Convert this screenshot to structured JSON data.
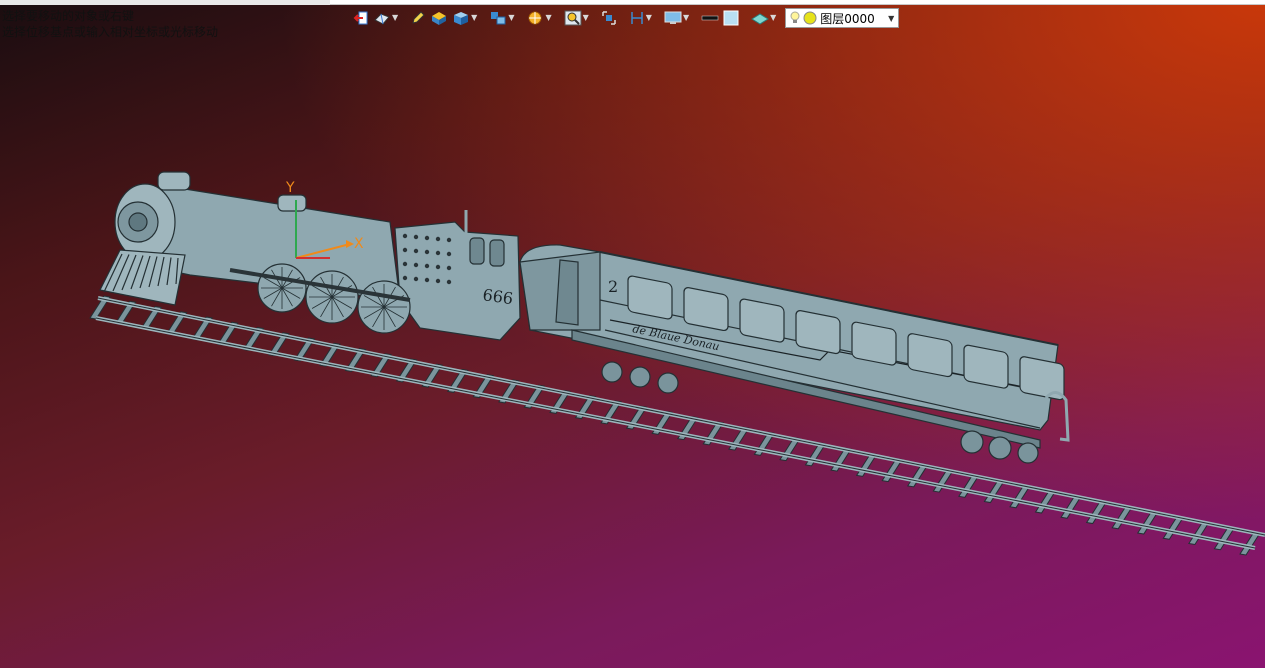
{
  "prompt": {
    "line1": "选择要移动的对象或右键",
    "line2": "选择位移基点或输入相对坐标或光标移动"
  },
  "toolbar": {
    "items": [
      {
        "name": "exit-icon",
        "dropdown": false
      },
      {
        "name": "view-icon",
        "dropdown": true
      },
      {
        "name": "pencil-icon",
        "dropdown": false
      },
      {
        "name": "shade-icon",
        "dropdown": false
      },
      {
        "name": "cube-icon",
        "dropdown": true
      },
      {
        "name": "cubes-icon",
        "dropdown": true
      },
      {
        "name": "section-icon",
        "dropdown": true
      },
      {
        "name": "zoom-icon",
        "dropdown": true
      },
      {
        "name": "fit-icon",
        "dropdown": false
      },
      {
        "name": "measure-icon",
        "dropdown": true
      },
      {
        "name": "display-icon",
        "dropdown": true
      },
      {
        "name": "line-color-icon",
        "dropdown": false
      },
      {
        "name": "fill-color-icon",
        "dropdown": false
      },
      {
        "name": "material-icon",
        "dropdown": true
      }
    ],
    "layer_select": {
      "label": "图层0000"
    }
  },
  "model": {
    "loco_number": "666",
    "car_number": "2",
    "car_script": "de Blaue Donau",
    "axis_y": "Y",
    "axis_x": "X"
  },
  "colors": {
    "body": "#8fa8b0",
    "edge": "#2a3438",
    "axis": "#f08a1a"
  }
}
